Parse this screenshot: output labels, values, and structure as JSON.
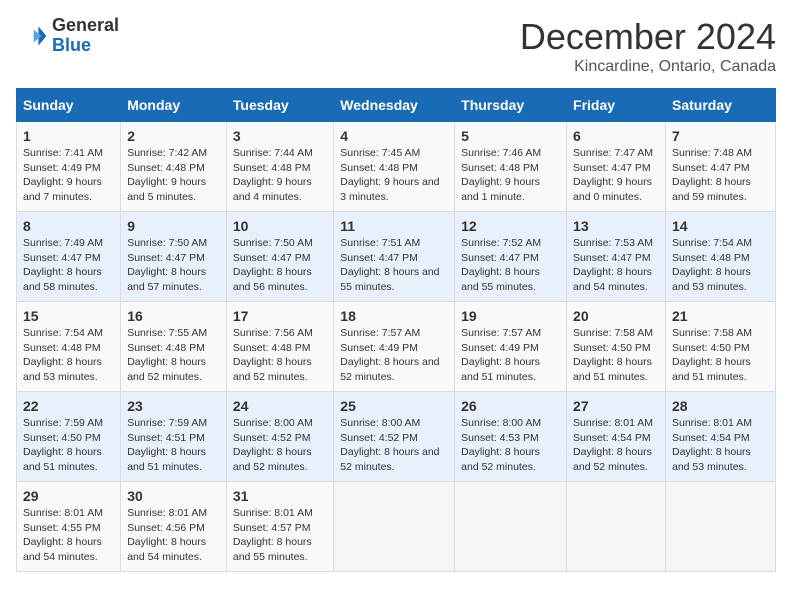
{
  "logo": {
    "general": "General",
    "blue": "Blue"
  },
  "header": {
    "month": "December 2024",
    "location": "Kincardine, Ontario, Canada"
  },
  "weekdays": [
    "Sunday",
    "Monday",
    "Tuesday",
    "Wednesday",
    "Thursday",
    "Friday",
    "Saturday"
  ],
  "weeks": [
    [
      {
        "day": "1",
        "sunrise": "7:41 AM",
        "sunset": "4:49 PM",
        "daylight": "9 hours and 7 minutes."
      },
      {
        "day": "2",
        "sunrise": "7:42 AM",
        "sunset": "4:48 PM",
        "daylight": "9 hours and 5 minutes."
      },
      {
        "day": "3",
        "sunrise": "7:44 AM",
        "sunset": "4:48 PM",
        "daylight": "9 hours and 4 minutes."
      },
      {
        "day": "4",
        "sunrise": "7:45 AM",
        "sunset": "4:48 PM",
        "daylight": "9 hours and 3 minutes."
      },
      {
        "day": "5",
        "sunrise": "7:46 AM",
        "sunset": "4:48 PM",
        "daylight": "9 hours and 1 minute."
      },
      {
        "day": "6",
        "sunrise": "7:47 AM",
        "sunset": "4:47 PM",
        "daylight": "9 hours and 0 minutes."
      },
      {
        "day": "7",
        "sunrise": "7:48 AM",
        "sunset": "4:47 PM",
        "daylight": "8 hours and 59 minutes."
      }
    ],
    [
      {
        "day": "8",
        "sunrise": "7:49 AM",
        "sunset": "4:47 PM",
        "daylight": "8 hours and 58 minutes."
      },
      {
        "day": "9",
        "sunrise": "7:50 AM",
        "sunset": "4:47 PM",
        "daylight": "8 hours and 57 minutes."
      },
      {
        "day": "10",
        "sunrise": "7:50 AM",
        "sunset": "4:47 PM",
        "daylight": "8 hours and 56 minutes."
      },
      {
        "day": "11",
        "sunrise": "7:51 AM",
        "sunset": "4:47 PM",
        "daylight": "8 hours and 55 minutes."
      },
      {
        "day": "12",
        "sunrise": "7:52 AM",
        "sunset": "4:47 PM",
        "daylight": "8 hours and 55 minutes."
      },
      {
        "day": "13",
        "sunrise": "7:53 AM",
        "sunset": "4:47 PM",
        "daylight": "8 hours and 54 minutes."
      },
      {
        "day": "14",
        "sunrise": "7:54 AM",
        "sunset": "4:48 PM",
        "daylight": "8 hours and 53 minutes."
      }
    ],
    [
      {
        "day": "15",
        "sunrise": "7:54 AM",
        "sunset": "4:48 PM",
        "daylight": "8 hours and 53 minutes."
      },
      {
        "day": "16",
        "sunrise": "7:55 AM",
        "sunset": "4:48 PM",
        "daylight": "8 hours and 52 minutes."
      },
      {
        "day": "17",
        "sunrise": "7:56 AM",
        "sunset": "4:48 PM",
        "daylight": "8 hours and 52 minutes."
      },
      {
        "day": "18",
        "sunrise": "7:57 AM",
        "sunset": "4:49 PM",
        "daylight": "8 hours and 52 minutes."
      },
      {
        "day": "19",
        "sunrise": "7:57 AM",
        "sunset": "4:49 PM",
        "daylight": "8 hours and 51 minutes."
      },
      {
        "day": "20",
        "sunrise": "7:58 AM",
        "sunset": "4:50 PM",
        "daylight": "8 hours and 51 minutes."
      },
      {
        "day": "21",
        "sunrise": "7:58 AM",
        "sunset": "4:50 PM",
        "daylight": "8 hours and 51 minutes."
      }
    ],
    [
      {
        "day": "22",
        "sunrise": "7:59 AM",
        "sunset": "4:50 PM",
        "daylight": "8 hours and 51 minutes."
      },
      {
        "day": "23",
        "sunrise": "7:59 AM",
        "sunset": "4:51 PM",
        "daylight": "8 hours and 51 minutes."
      },
      {
        "day": "24",
        "sunrise": "8:00 AM",
        "sunset": "4:52 PM",
        "daylight": "8 hours and 52 minutes."
      },
      {
        "day": "25",
        "sunrise": "8:00 AM",
        "sunset": "4:52 PM",
        "daylight": "8 hours and 52 minutes."
      },
      {
        "day": "26",
        "sunrise": "8:00 AM",
        "sunset": "4:53 PM",
        "daylight": "8 hours and 52 minutes."
      },
      {
        "day": "27",
        "sunrise": "8:01 AM",
        "sunset": "4:54 PM",
        "daylight": "8 hours and 52 minutes."
      },
      {
        "day": "28",
        "sunrise": "8:01 AM",
        "sunset": "4:54 PM",
        "daylight": "8 hours and 53 minutes."
      }
    ],
    [
      {
        "day": "29",
        "sunrise": "8:01 AM",
        "sunset": "4:55 PM",
        "daylight": "8 hours and 54 minutes."
      },
      {
        "day": "30",
        "sunrise": "8:01 AM",
        "sunset": "4:56 PM",
        "daylight": "8 hours and 54 minutes."
      },
      {
        "day": "31",
        "sunrise": "8:01 AM",
        "sunset": "4:57 PM",
        "daylight": "8 hours and 55 minutes."
      },
      null,
      null,
      null,
      null
    ]
  ]
}
